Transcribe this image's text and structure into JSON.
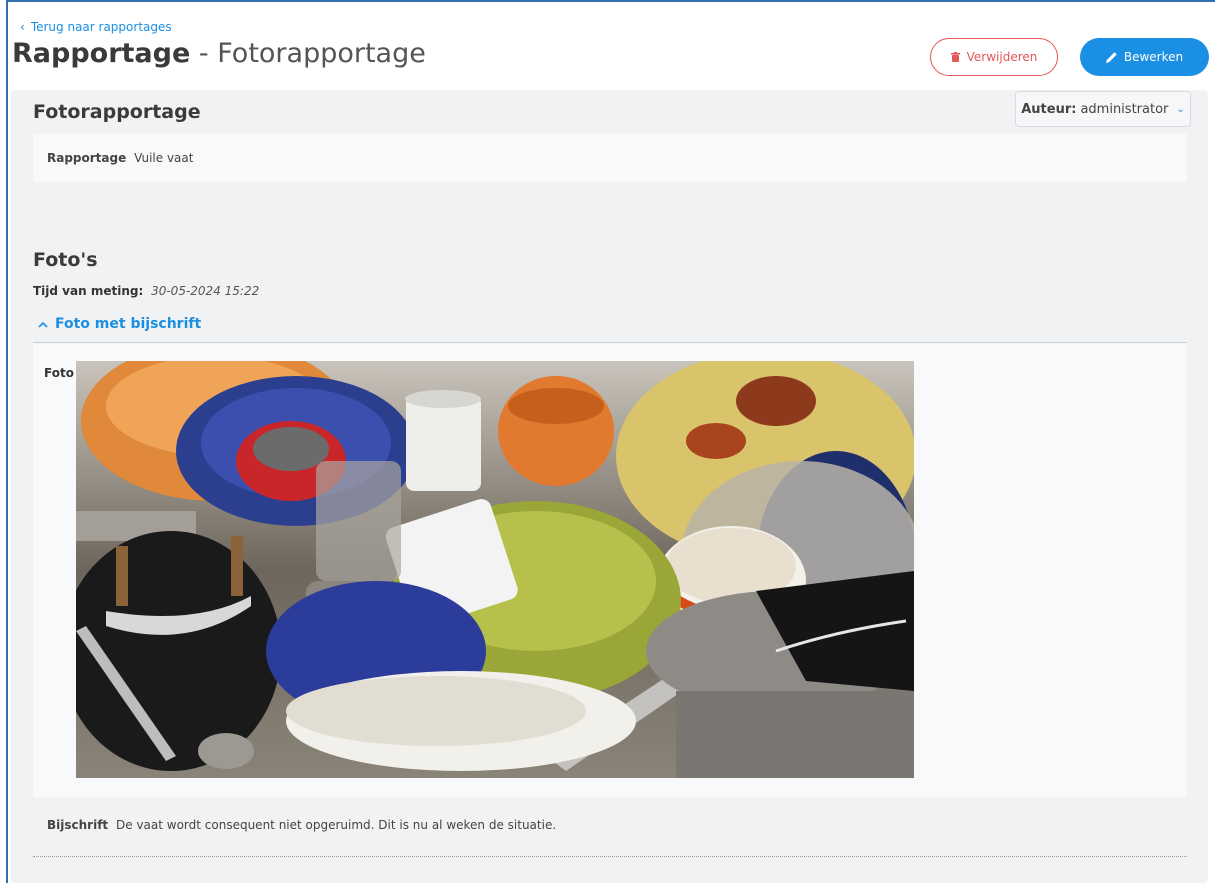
{
  "nav": {
    "back_label": "Terug naar rapportages"
  },
  "header": {
    "title_strong": "Rapportage",
    "title_sep": "-",
    "title_sub": "Fotorapportage",
    "delete_label": "Verwijderen",
    "edit_label": "Bewerken"
  },
  "section1": {
    "title": "Fotorapportage",
    "author_label": "Auteur:",
    "author_value": "administrator",
    "field_label": "Rapportage",
    "field_value": "Vuile vaat"
  },
  "section2": {
    "title": "Foto's",
    "time_label": "Tijd van meting:",
    "time_value": "30-05-2024 15:22",
    "collapse_label": "Foto met bijschrift",
    "photo_label": "Foto",
    "caption_label": "Bijschrift",
    "caption_value": "De vaat wordt consequent niet opgeruimd. Dit is nu al weken de situatie."
  },
  "colors": {
    "accent": "#1a8fe3",
    "danger": "#e25757",
    "panel": "#f1f2f4"
  }
}
